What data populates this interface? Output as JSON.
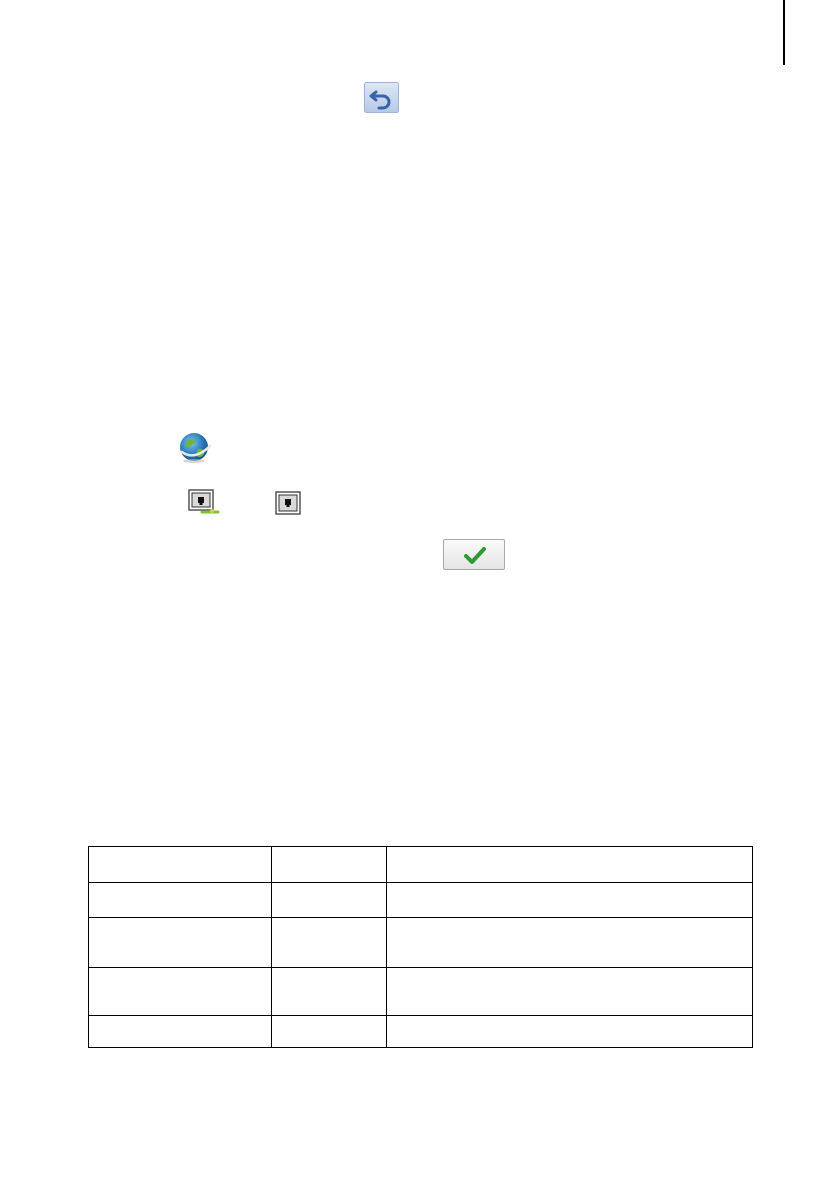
{
  "icons": {
    "undo": "undo-icon",
    "globe": "globe-icon",
    "ethernet_active": "ethernet-connected-icon",
    "ethernet": "ethernet-icon",
    "confirm": "checkmark-icon"
  },
  "colors": {
    "undo_bg": "#c7d6ee",
    "undo_arrow": "#3a64a8",
    "globe_blue": "#2a79b8",
    "globe_green": "#6fb53a",
    "check_green": "#2f9a2f",
    "margin_line": "#000000"
  },
  "table": {
    "rows": [
      {
        "c1": "",
        "c2": "",
        "c3": ""
      },
      {
        "c1": "",
        "c2": "",
        "c3": ""
      },
      {
        "c1": "",
        "c2": "",
        "c3": ""
      },
      {
        "c1": "",
        "c2": "",
        "c3": ""
      },
      {
        "c1": "",
        "c2": "",
        "c3": ""
      }
    ]
  }
}
